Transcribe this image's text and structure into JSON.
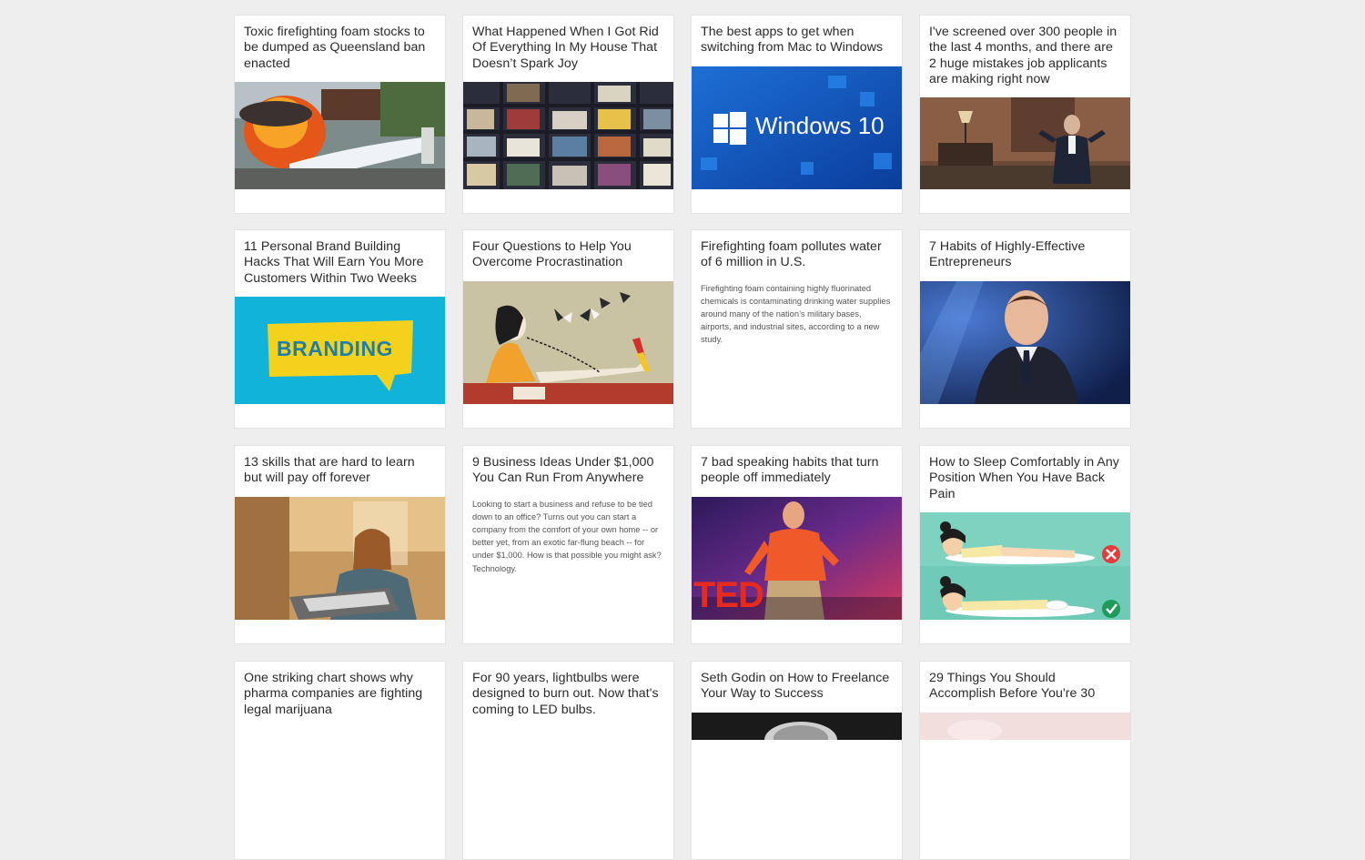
{
  "cards": [
    {
      "title": "Toxic firefighting foam stocks to be dumped as Queensland ban enacted",
      "image": "fire-foam-photo"
    },
    {
      "title": "What Happened When I Got Rid Of Everything In My House That Doesn’t Spark Joy",
      "image": "bookshelf-photo"
    },
    {
      "title": "The best apps to get when switching from Mac to Windows",
      "image": "windows10-photo",
      "image_text": "Windows 10"
    },
    {
      "title": "I've screened over 300 people in the last 4 months, and there are 2 huge mistakes job applicants are making right now",
      "image": "office-man-photo"
    },
    {
      "title": "11 Personal Brand Building Hacks That Will Earn You More Customers Within Two Weeks",
      "image": "branding-photo",
      "image_text": "BRANDING"
    },
    {
      "title": "Four Questions to Help You Overcome Procrastination",
      "image": "procrastination-illustration"
    },
    {
      "title": "Firefighting foam pollutes water of 6 million in U.S.",
      "description": "Firefighting foam containing highly fluorinated chemicals is contaminating drinking water supplies around many of the nation’s military bases, airports, and industrial sites, according to a new study."
    },
    {
      "title": "7 Habits of Highly-Effective Entrepreneurs",
      "image": "entrepreneur-photo"
    },
    {
      "title": "13 skills that are hard to learn but will pay off forever",
      "image": "woman-laptop-photo"
    },
    {
      "title": "9 Business Ideas Under $1,000 You Can Run From Anywhere",
      "description": "Looking to start a business and refuse to be tied down to an office? Turns out you can start a company from the comfort of your own home -- or better yet, from an exotic far-flung beach -- for under $1,000. How is that possible you might ask? Technology."
    },
    {
      "title": "7 bad speaking habits that turn people off immediately",
      "image": "ted-speaker-photo",
      "image_text": "TED"
    },
    {
      "title": "How to Sleep Comfortably in Any Position When You Have Back Pain",
      "image": "sleep-illustration"
    },
    {
      "title": "One striking chart shows why pharma companies are fighting legal marijuana"
    },
    {
      "title": "For 90 years, lightbulbs were designed to burn out. Now that's coming to LED bulbs."
    },
    {
      "title": "Seth Godin on How to Freelance Your Way to Success",
      "image": "seth-godin-photo"
    },
    {
      "title": "29 Things You Should Accomplish Before You're 30",
      "image": "pink-photo"
    }
  ]
}
